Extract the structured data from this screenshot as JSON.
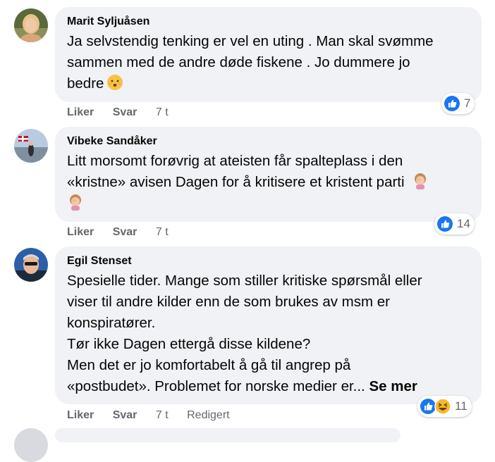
{
  "comments": [
    {
      "author": "Marit Syljuåsen",
      "lines": [
        "Ja selvstendig tenking er vel en uting . Man skal svømme",
        "sammen med de andre døde fiskene . Jo dummere jo",
        "bedre"
      ],
      "emoji": "hushed-face-emoji",
      "actions": {
        "like": "Liker",
        "reply": "Svar",
        "time": "7 t"
      },
      "reaction_count": "7"
    },
    {
      "author": "Vibeke Sandåker",
      "lines": [
        "Litt morsomt forøvrig at ateisten får spalteplass i den",
        "«kristne» avisen Dagen for å kritisere et kristent parti"
      ],
      "emoji": "facepalm-woman-emoji",
      "actions": {
        "like": "Liker",
        "reply": "Svar",
        "time": "7 t"
      },
      "reaction_count": "14"
    },
    {
      "author": "Egil Stenset",
      "lines": [
        "Spesielle tider. Mange som stiller kritiske spørsmål eller",
        "viser til andre kilder enn de som brukes av msm er",
        "konspiratører.",
        "Tør ikke Dagen ettergå disse kildene?",
        "Men det er jo komfortabelt å gå til angrep på",
        "«postbudet». Problemet for norske medier er..."
      ],
      "see_more": "Se mer",
      "actions": {
        "like": "Liker",
        "reply": "Svar",
        "time": "7 t",
        "edited": "Redigert"
      },
      "reaction_count": "11"
    }
  ],
  "colors": {
    "bubble_bg": "#f0f2f5",
    "meta_text": "#65676b",
    "like_blue": "#1877f2",
    "haha_yellow": "#f7b928"
  }
}
